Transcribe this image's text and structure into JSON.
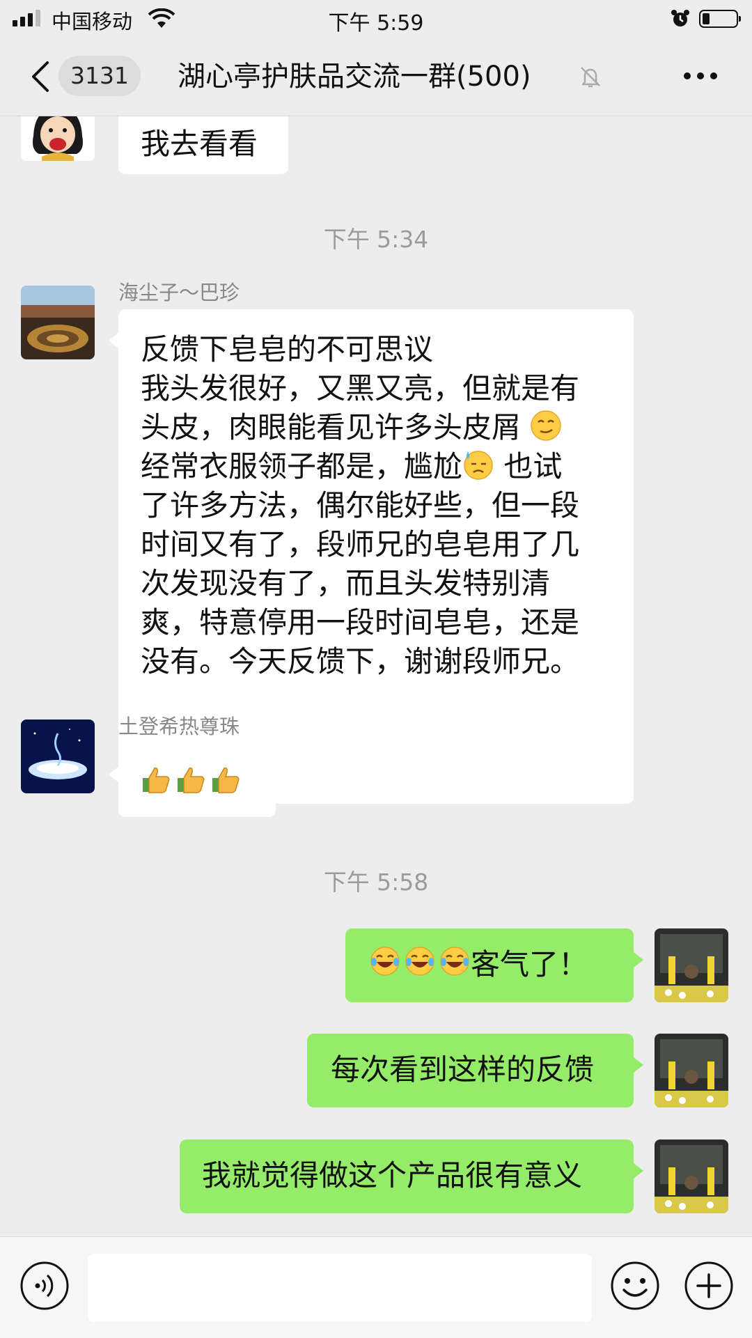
{
  "status_bar": {
    "carrier": "中国移动",
    "time": "下午 5:59"
  },
  "header": {
    "unread_count": "3131",
    "title": "湖心亭护肤品交流一群(500)"
  },
  "messages": {
    "m1_text": "我去看看",
    "ts1": "下午 5:34",
    "m2_sender": "海尘子～巴珍",
    "m2_lines": [
      "反馈下皂皂的不可思议",
      "我头发很好，又黑又亮，但就是有",
      "头皮，肉眼能看见许多头皮屑",
      "经常衣服领子都是，尴尬",
      "也试",
      "了许多方法，偶尔能好些，但一段",
      "时间又有了，段师兄的皂皂用了几",
      "次发现没有了，而且头发特别清",
      "爽，特意停用一段时间皂皂，还是",
      "没有。今天反馈下，谢谢段师兄。"
    ],
    "m3_sender": "土登希热尊珠",
    "m3_emojis": "thumbs-up x3",
    "ts2": "下午 5:58",
    "m4_text": "客气了！",
    "m5_text": "每次看到这样的反馈",
    "m6_text": "我就觉得做这个产品很有意义"
  },
  "input": {
    "placeholder": ""
  },
  "colors": {
    "background": "#ededed",
    "outgoing_bubble": "#95ec69",
    "incoming_bubble": "#ffffff",
    "timestamp": "#9b9b9b"
  },
  "icons": [
    "back-icon",
    "mute-bell-icon",
    "more-icon",
    "voice-icon",
    "emoji-icon",
    "plus-icon",
    "wifi-icon",
    "alarm-icon",
    "battery-icon"
  ]
}
